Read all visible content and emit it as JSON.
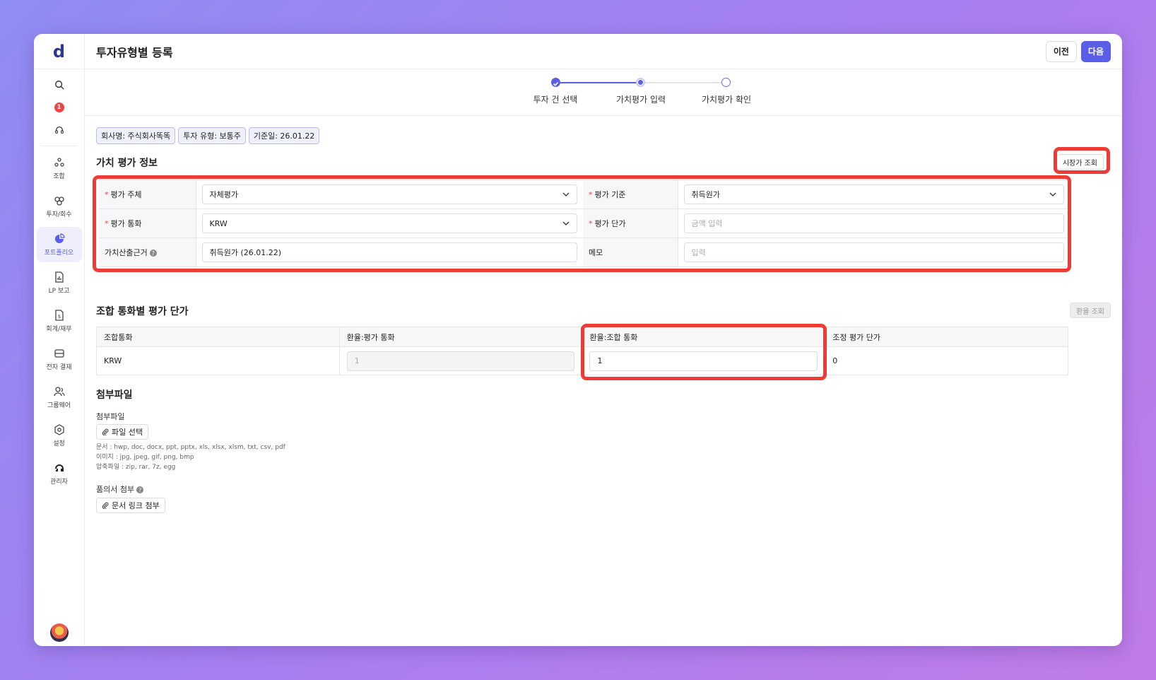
{
  "app": {
    "logo": "d",
    "title": "투자유형별 등록"
  },
  "header": {
    "prev_label": "이전",
    "next_label": "다음"
  },
  "sidebar": {
    "notification_count": "1",
    "items": [
      {
        "label": "조합",
        "icon": "union-icon"
      },
      {
        "label": "투자/회수",
        "icon": "invest-icon"
      },
      {
        "label": "포트폴리오",
        "icon": "portfolio-icon",
        "active": true
      },
      {
        "label": "LP 보고",
        "icon": "report-icon"
      },
      {
        "label": "회계/재무",
        "icon": "accounting-icon"
      },
      {
        "label": "전자 결재",
        "icon": "approval-icon"
      },
      {
        "label": "그룹웨어",
        "icon": "groupware-icon"
      },
      {
        "label": "설정",
        "icon": "settings-icon"
      },
      {
        "label": "관리자",
        "icon": "admin-icon"
      }
    ]
  },
  "stepper": {
    "steps": [
      "투자 건 선택",
      "가치평가 입력",
      "가치평가 확인"
    ],
    "current": 2
  },
  "tags": [
    "회사명: 주식회사똑똑",
    "투자 유형: 보통주",
    "기준일: 26.01.22"
  ],
  "valuation": {
    "title": "가치 평가 정보",
    "market_btn": "시장가 조회",
    "rows": [
      {
        "l1": "평가 주체",
        "v1": "자체평가",
        "l2": "평가 기준",
        "v2": "취득원가"
      },
      {
        "l1": "평가 통화",
        "v1": "KRW",
        "l2": "평가 단가",
        "p2": "금액 입력"
      },
      {
        "l1": "가치산출근거",
        "v1": "취득원가 (26.01.22)",
        "l2": "메모",
        "p2": "입력"
      }
    ]
  },
  "rates": {
    "title": "조합 통화별 평가 단가",
    "btn": "환율 조회",
    "headers": [
      "조합통화",
      "환율:평가 통화",
      "환율:조합 통화",
      "조정 평가 단가"
    ],
    "row": {
      "currency": "KRW",
      "eval_rate": "1",
      "fund_rate": "1",
      "adjusted": "0"
    }
  },
  "attachments": {
    "title": "첨부파일",
    "file_label": "첨부파일",
    "file_btn": "파일 선택",
    "hints": [
      "문서 : hwp, doc, docx, ppt, pptx, xls, xlsx, xlsm, txt, csv, pdf",
      "이미지 : jpg, jpeg, gif, png, bmp",
      "압축파일 : zip, rar, 7z, egg"
    ],
    "approval_label": "품의서 첨부",
    "approval_btn": "문서 링크 첨부"
  },
  "colors": {
    "accent": "#5b5ee6",
    "highlight": "#ef3b36",
    "required": "#ef4444"
  }
}
